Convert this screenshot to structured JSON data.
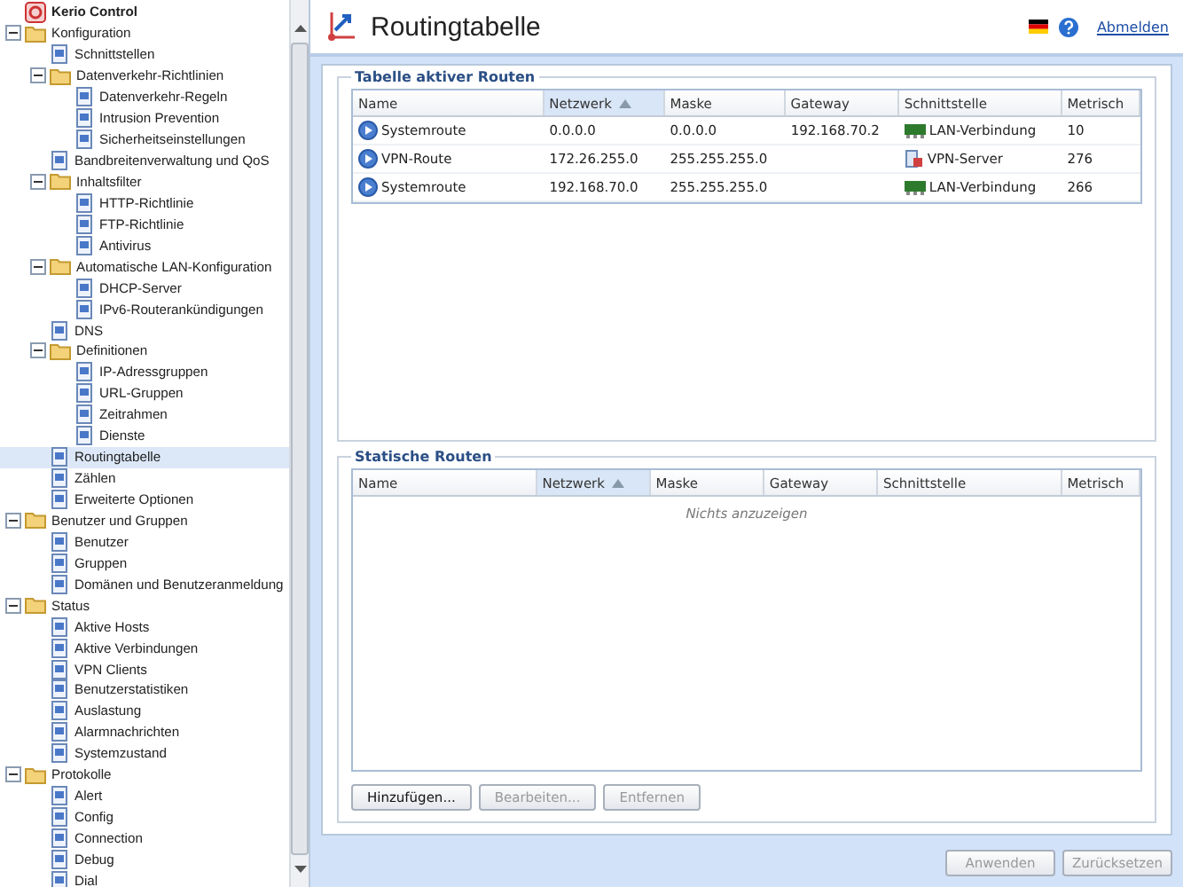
{
  "tree": {
    "title": "Kerio Control",
    "items": [
      {
        "label": "Konfiguration",
        "selected": false,
        "expanded": true,
        "children": [
          {
            "label": "Schnittstellen",
            "selected": false
          },
          {
            "label": "Datenverkehr-Richtlinien",
            "selected": false,
            "expanded": true,
            "children": [
              {
                "label": "Datenverkehr-Regeln",
                "selected": false
              },
              {
                "label": "Intrusion Prevention",
                "selected": false
              },
              {
                "label": "Sicherheitseinstellungen",
                "selected": false
              }
            ]
          },
          {
            "label": "Bandbreitenverwaltung und QoS",
            "selected": false
          },
          {
            "label": "Inhaltsfilter",
            "selected": false,
            "expanded": true,
            "children": [
              {
                "label": "HTTP-Richtlinie",
                "selected": false
              },
              {
                "label": "FTP-Richtlinie",
                "selected": false
              },
              {
                "label": "Antivirus",
                "selected": false
              }
            ]
          },
          {
            "label": "Automatische LAN-Konfiguration",
            "selected": false,
            "expanded": true,
            "children": [
              {
                "label": "DHCP-Server",
                "selected": false
              },
              {
                "label": "IPv6-Routerankündigungen",
                "selected": false
              }
            ]
          },
          {
            "label": "DNS",
            "selected": false
          },
          {
            "label": "Definitionen",
            "selected": false,
            "expanded": true,
            "children": [
              {
                "label": "IP-Adressgruppen",
                "selected": false
              },
              {
                "label": "URL-Gruppen",
                "selected": false
              },
              {
                "label": "Zeitrahmen",
                "selected": false
              },
              {
                "label": "Dienste",
                "selected": false
              }
            ]
          },
          {
            "label": "Routingtabelle",
            "selected": true
          },
          {
            "label": "Zählen",
            "selected": false
          },
          {
            "label": "Erweiterte Optionen",
            "selected": false
          }
        ]
      },
      {
        "label": "Benutzer und Gruppen",
        "selected": false,
        "expanded": true,
        "children": [
          {
            "label": "Benutzer",
            "selected": false
          },
          {
            "label": "Gruppen",
            "selected": false
          },
          {
            "label": "Domänen und Benutzeranmeldung",
            "selected": false
          }
        ]
      },
      {
        "label": "Status",
        "selected": false,
        "expanded": true,
        "children": [
          {
            "label": "Aktive Hosts",
            "selected": false
          },
          {
            "label": "Aktive Verbindungen",
            "selected": false
          },
          {
            "label": "VPN Clients",
            "selected": false
          },
          {
            "label": "Benutzerstatistiken",
            "selected": false
          },
          {
            "label": "Auslastung",
            "selected": false
          },
          {
            "label": "Alarmnachrichten",
            "selected": false
          },
          {
            "label": "Systemzustand",
            "selected": false
          }
        ]
      },
      {
        "label": "Protokolle",
        "selected": false,
        "expanded": true,
        "children": [
          {
            "label": "Alert",
            "selected": false
          },
          {
            "label": "Config",
            "selected": false
          },
          {
            "label": "Connection",
            "selected": false
          },
          {
            "label": "Debug",
            "selected": false
          },
          {
            "label": "Dial",
            "selected": false
          }
        ]
      }
    ]
  },
  "header": {
    "title": "Routingtabelle",
    "logout": "Abmelden"
  },
  "active_routes": {
    "title": "Tabelle aktiver Routen",
    "columns": [
      {
        "label": "Name",
        "sorted": false
      },
      {
        "label": "Netzwerk",
        "sorted": true
      },
      {
        "label": "Maske",
        "sorted": false
      },
      {
        "label": "Gateway",
        "sorted": false
      },
      {
        "label": "Schnittstelle",
        "sorted": false
      },
      {
        "label": "Metrisch",
        "sorted": false
      }
    ],
    "rows": [
      {
        "name": "Systemroute",
        "network": "0.0.0.0",
        "mask": "0.0.0.0",
        "gateway": "192.168.70.2",
        "interface": "LAN-Verbindung",
        "kind": "lan",
        "metric": "10"
      },
      {
        "name": "VPN-Route",
        "network": "172.26.255.0",
        "mask": "255.255.255.0",
        "gateway": "",
        "interface": "VPN-Server",
        "kind": "vpn",
        "metric": "276"
      },
      {
        "name": "Systemroute",
        "network": "192.168.70.0",
        "mask": "255.255.255.0",
        "gateway": "",
        "interface": "LAN-Verbindung",
        "kind": "lan",
        "metric": "266"
      }
    ]
  },
  "static_routes": {
    "title": "Statische Routen",
    "columns": [
      {
        "label": "Name",
        "sorted": false
      },
      {
        "label": "Netzwerk",
        "sorted": true
      },
      {
        "label": "Maske",
        "sorted": false
      },
      {
        "label": "Gateway",
        "sorted": false
      },
      {
        "label": "Schnittstelle",
        "sorted": false
      },
      {
        "label": "Metrisch",
        "sorted": false
      }
    ],
    "empty_text": "Nichts anzuzeigen",
    "buttons": [
      {
        "label": "Hinzufügen...",
        "disabled": false
      },
      {
        "label": "Bearbeiten...",
        "disabled": true
      },
      {
        "label": "Entfernen",
        "disabled": true
      }
    ]
  },
  "footer_buttons": [
    {
      "label": "Anwenden",
      "disabled": true
    },
    {
      "label": "Zurücksetzen",
      "disabled": true
    }
  ]
}
